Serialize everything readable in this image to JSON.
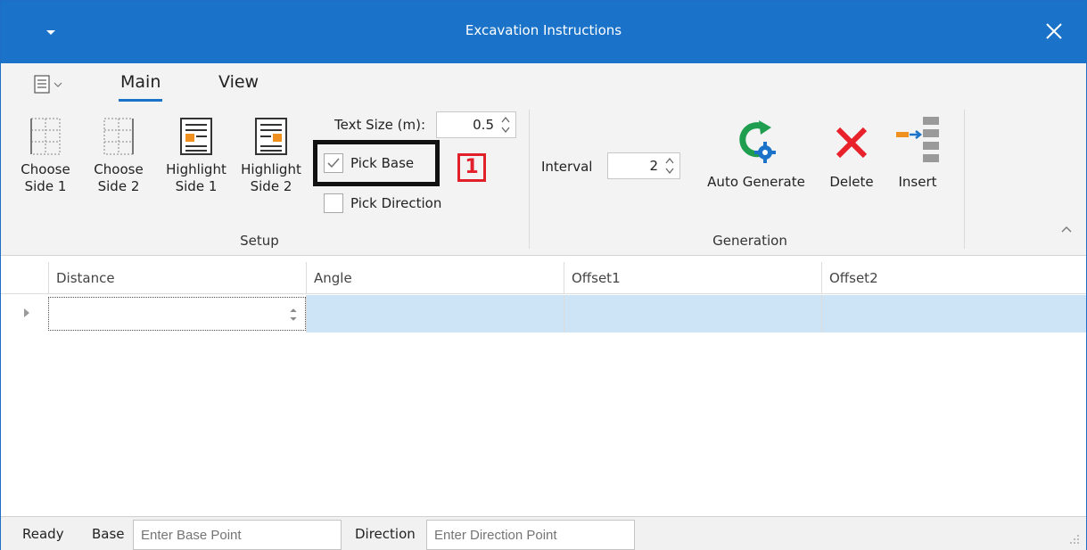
{
  "window": {
    "title": "Excavation Instructions"
  },
  "ribbon": {
    "tabs": [
      {
        "label": "Main",
        "active": true
      },
      {
        "label": "View",
        "active": false
      }
    ],
    "setup": {
      "group_label": "Setup",
      "buttons": [
        {
          "line1": "Choose",
          "line2": "Side 1"
        },
        {
          "line1": "Choose",
          "line2": "Side 2"
        },
        {
          "line1": "Highlight",
          "line2": "Side 1"
        },
        {
          "line1": "Highlight",
          "line2": "Side 2"
        }
      ],
      "text_size_label": "Text Size (m):",
      "text_size_value": "0.5",
      "pick_base_label": "Pick Base",
      "pick_base_checked": true,
      "pick_direction_label": "Pick Direction",
      "pick_direction_checked": false
    },
    "annotation_marker": "1",
    "generation": {
      "group_label": "Generation",
      "interval_label": "Interval",
      "interval_value": "2",
      "auto_generate_label": "Auto Generate",
      "delete_label": "Delete",
      "insert_label": "Insert"
    }
  },
  "grid": {
    "columns": [
      "Distance",
      "Angle",
      "Offset1",
      "Offset2"
    ]
  },
  "statusbar": {
    "ready": "Ready",
    "base_label": "Base",
    "base_placeholder": "Enter Base Point",
    "direction_label": "Direction",
    "direction_placeholder": "Enter Direction Point"
  },
  "colors": {
    "title_bar": "#1b73c9",
    "accent_orange": "#f0901e",
    "delete_red": "#e8212b",
    "auto_generate_green": "#1f9e4f",
    "selection_blue": "#cde4f7",
    "marker_red": "#e2202a"
  }
}
